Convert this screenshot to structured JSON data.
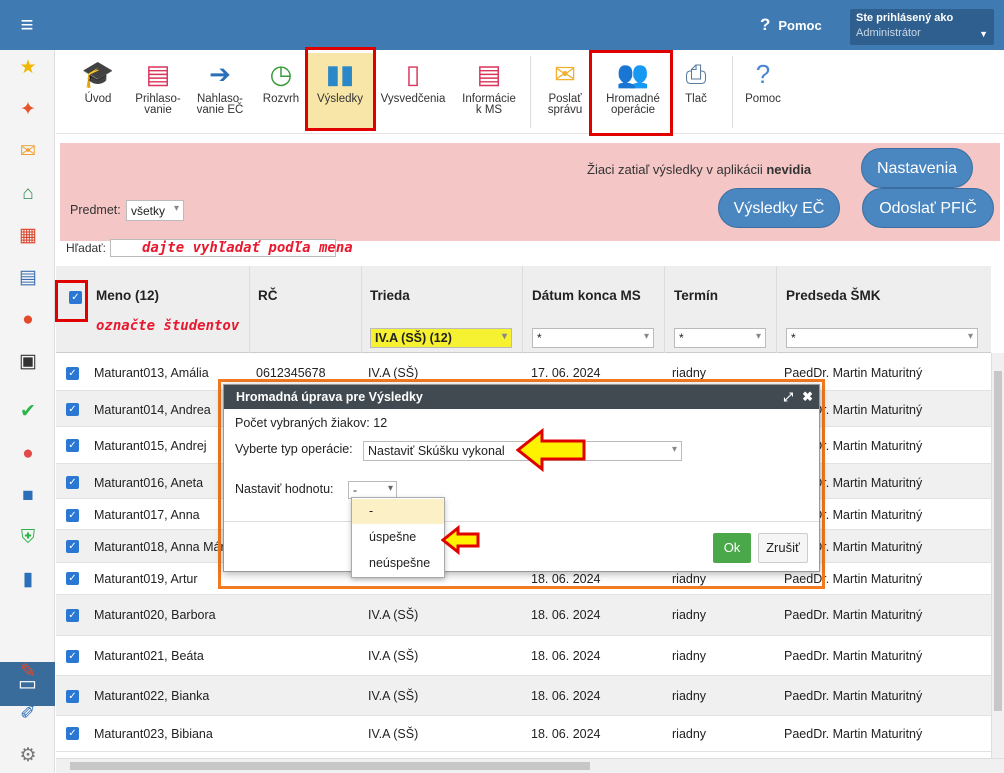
{
  "header": {
    "help_label": "Pomoc",
    "user_label": "Ste prihlásený ako",
    "user_name": "Administrátor"
  },
  "toolbar": {
    "items": [
      {
        "label": "Úvod",
        "icon": "graduates-icon"
      },
      {
        "label": "Prihlaso-\nvanie",
        "icon": "form-icon"
      },
      {
        "label": "Nahlaso-\nvanie EČ",
        "icon": "arrow-right-icon"
      },
      {
        "label": "Rozvrh",
        "icon": "clock-icon"
      },
      {
        "label": "Výsledky",
        "icon": "bar-chart-icon"
      },
      {
        "label": "Vysvedčenia",
        "icon": "certificate-icon"
      },
      {
        "label": "Informácie\nk MS",
        "icon": "info-document-icon"
      },
      {
        "label": "Poslať\nsprávu",
        "icon": "envelope-icon"
      },
      {
        "label": "Hromadné\noperácie",
        "icon": "people-icon"
      },
      {
        "label": "Tlač",
        "icon": "printer-icon"
      },
      {
        "label": "Pomoc",
        "icon": "help-icon"
      }
    ]
  },
  "banner": {
    "message_prefix": "Žiaci zatiaľ výsledky v aplikácii ",
    "message_bold": "nevidia",
    "btn_settings": "Nastavenia",
    "btn_results": "Výsledky EČ",
    "btn_send": "Odoslať PFIČ"
  },
  "filters": {
    "subject_label": "Predmet:",
    "subject_value": "všetky",
    "search_label": "Hľadať:"
  },
  "annotations": {
    "search_hint": "dajte vyhľadať podľa mena",
    "select_hint": "označte študentov"
  },
  "table": {
    "headers": [
      "Meno (12)",
      "RČ",
      "Trieda",
      "Dátum konca MS",
      "Termín",
      "Predseda ŠMK"
    ],
    "filters": [
      "",
      "",
      "IV.A (SŠ) (12)",
      "*",
      "*",
      "*"
    ],
    "rows": [
      {
        "name": "Maturant013, Amália",
        "rc": "0612345678",
        "trieda": "IV.A (SŠ)",
        "datum": "17. 06. 2024",
        "termin": "riadny",
        "predseda": "PaedDr. Martin Maturitný"
      },
      {
        "name": "Maturant014, Andrea",
        "rc": "",
        "trieda": "",
        "datum": "",
        "termin": "",
        "predseda": "PaedDr. Martin Maturitný"
      },
      {
        "name": "Maturant015, Andrej",
        "rc": "",
        "trieda": "",
        "datum": "",
        "termin": "",
        "predseda": "PaedDr. Martin Maturitný"
      },
      {
        "name": "Maturant016, Aneta",
        "rc": "",
        "trieda": "",
        "datum": "",
        "termin": "",
        "predseda": "PaedDr. Martin Maturitný"
      },
      {
        "name": "Maturant017, Anna",
        "rc": "",
        "trieda": "",
        "datum": "",
        "termin": "",
        "predseda": "PaedDr. Martin Maturitný"
      },
      {
        "name": "Maturant018, Anna Már",
        "rc": "",
        "trieda": "",
        "datum": "",
        "termin": "",
        "predseda": "PaedDr. Martin Maturitný"
      },
      {
        "name": "Maturant019, Artur",
        "rc": "",
        "trieda": "",
        "datum": "18. 06. 2024",
        "termin": "riadny",
        "predseda": "PaedDr. Martin Maturitný"
      },
      {
        "name": "Maturant020, Barbora",
        "rc": "",
        "trieda": "IV.A (SŠ)",
        "datum": "18. 06. 2024",
        "termin": "riadny",
        "predseda": "PaedDr. Martin Maturitný"
      },
      {
        "name": "Maturant021, Beáta",
        "rc": "",
        "trieda": "IV.A (SŠ)",
        "datum": "18. 06. 2024",
        "termin": "riadny",
        "predseda": "PaedDr. Martin Maturitný"
      },
      {
        "name": "Maturant022, Bianka",
        "rc": "",
        "trieda": "IV.A (SŠ)",
        "datum": "18. 06. 2024",
        "termin": "riadny",
        "predseda": "PaedDr. Martin Maturitný"
      },
      {
        "name": "Maturant023, Bibiana",
        "rc": "",
        "trieda": "IV.A (SŠ)",
        "datum": "18. 06. 2024",
        "termin": "riadny",
        "predseda": "PaedDr. Martin Maturitný"
      }
    ]
  },
  "dialog": {
    "title": "Hromadná úprava pre Výsledky",
    "count_text": "Počet vybraných žiakov: 12",
    "op_label": "Vyberte typ operácie:",
    "op_value": "Nastaviť Skúšku vykonal",
    "value_label": "Nastaviť hodnotu:",
    "value_value": "-",
    "options": [
      "-",
      "úspešne",
      "neúspešne"
    ],
    "ok": "Ok",
    "cancel": "Zrušiť"
  },
  "colors": {
    "topbar": "#3f7ab3",
    "highlight_red": "#e00000",
    "orange_frame": "#f47a20",
    "arrow_yellow": "#fff200"
  }
}
